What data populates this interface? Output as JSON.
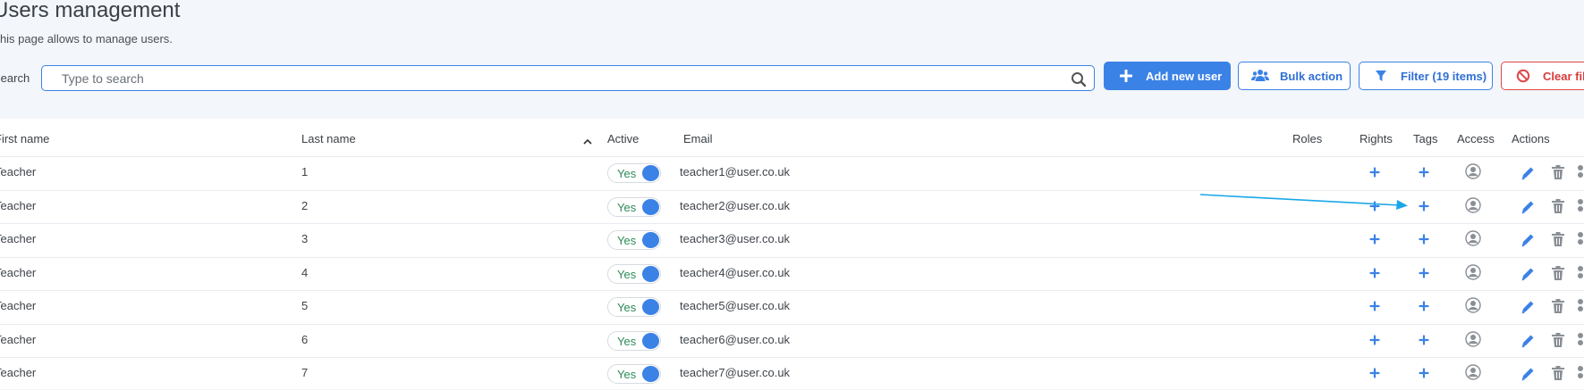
{
  "page": {
    "title": "Users management",
    "subtitle": "This page allows to manage users."
  },
  "search": {
    "label": "Search",
    "placeholder": "Type to search",
    "value": ""
  },
  "toolbar": {
    "add_label": "Add new user",
    "bulk_label": "Bulk action",
    "filter_label": "Filter (19 items)",
    "clear_label": "Clear filters"
  },
  "table": {
    "headers": {
      "first_name": "First name",
      "last_name": "Last name",
      "active": "Active",
      "email": "Email",
      "roles": "Roles",
      "rights": "Rights",
      "tags": "Tags",
      "access": "Access",
      "actions": "Actions"
    },
    "sort_column": "Last name",
    "sort_direction": "ascending",
    "rows": [
      {
        "first_name": "Teacher",
        "last_name": "1",
        "active": "Yes",
        "email": "teacher1@user.co.uk",
        "roles": ""
      },
      {
        "first_name": "Teacher",
        "last_name": "2",
        "active": "Yes",
        "email": "teacher2@user.co.uk",
        "roles": ""
      },
      {
        "first_name": "Teacher",
        "last_name": "3",
        "active": "Yes",
        "email": "teacher3@user.co.uk",
        "roles": ""
      },
      {
        "first_name": "Teacher",
        "last_name": "4",
        "active": "Yes",
        "email": "teacher4@user.co.uk",
        "roles": ""
      },
      {
        "first_name": "Teacher",
        "last_name": "5",
        "active": "Yes",
        "email": "teacher5@user.co.uk",
        "roles": ""
      },
      {
        "first_name": "Teacher",
        "last_name": "6",
        "active": "Yes",
        "email": "teacher6@user.co.uk",
        "roles": ""
      },
      {
        "first_name": "Teacher",
        "last_name": "7",
        "active": "Yes",
        "email": "teacher7@user.co.uk",
        "roles": ""
      }
    ]
  },
  "icons": {
    "search": "search-icon",
    "add": "plus-icon",
    "bulk": "users-group-icon",
    "filter": "funnel-icon",
    "clear": "ban-icon",
    "sort": "chevron-up-icon",
    "rights_add": "plus-icon",
    "tags_add": "plus-icon",
    "access": "user-circle-icon",
    "edit": "pencil-icon",
    "delete": "trash-icon",
    "more": "more-icon"
  },
  "colors": {
    "accent": "#3b82e6",
    "danger": "#e04848",
    "active_text": "#2e8b57",
    "annotation_arrow": "#1aa7e8",
    "background": "#f3f6fa"
  }
}
